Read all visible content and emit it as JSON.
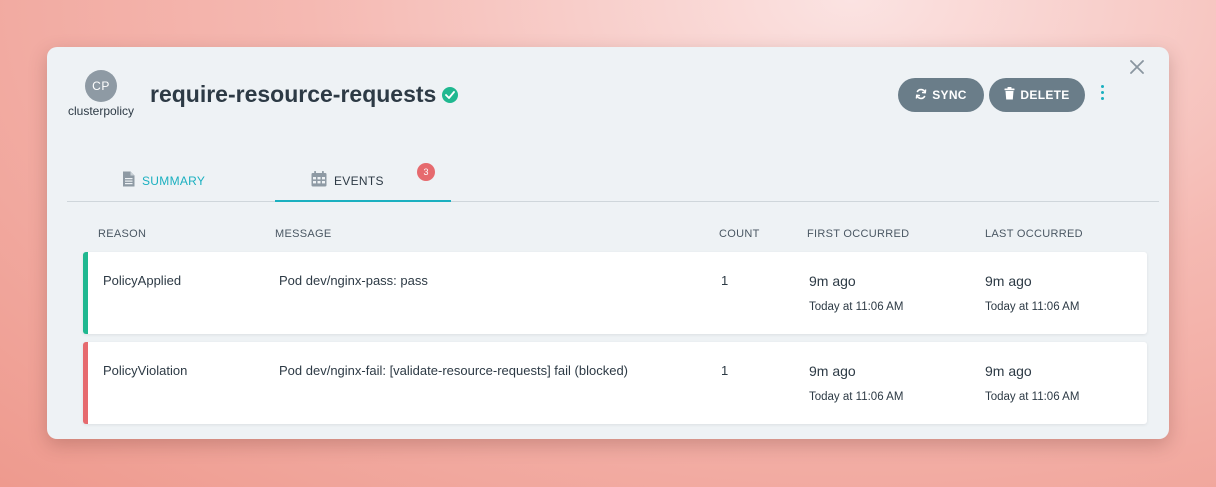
{
  "colors": {
    "accent": "#1bb0c0",
    "success": "#1fb890",
    "danger": "#e66a6e",
    "button_bg": "#6a7d89",
    "text": "#2d3a45"
  },
  "header": {
    "avatar_initials": "CP",
    "kind": "clusterpolicy",
    "title": "require-resource-requests",
    "status_icon": "check-circle-icon",
    "sync_label": "SYNC",
    "sync_icon": "refresh-icon",
    "delete_label": "DELETE",
    "delete_icon": "trash-icon",
    "more_icon": "kebab-menu-icon",
    "close_icon": "close-icon"
  },
  "tabs": [
    {
      "label": "SUMMARY",
      "icon": "document-icon",
      "active": false
    },
    {
      "label": "EVENTS",
      "icon": "calendar-icon",
      "active": true,
      "badge": "3"
    }
  ],
  "table": {
    "columns": [
      "REASON",
      "MESSAGE",
      "COUNT",
      "FIRST OCCURRED",
      "LAST OCCURRED"
    ],
    "rows": [
      {
        "reason": "PolicyApplied",
        "message": "Pod dev/nginx-pass: pass",
        "count": "1",
        "first_relative": "9m ago",
        "first_absolute": "Today at 11:06 AM",
        "last_relative": "9m ago",
        "last_absolute": "Today at 11:06 AM",
        "status": "success"
      },
      {
        "reason": "PolicyViolation",
        "message": "Pod dev/nginx-fail: [validate-resource-requests] fail (blocked)",
        "count": "1",
        "first_relative": "9m ago",
        "first_absolute": "Today at 11:06 AM",
        "last_relative": "9m ago",
        "last_absolute": "Today at 11:06 AM",
        "status": "danger"
      }
    ]
  }
}
